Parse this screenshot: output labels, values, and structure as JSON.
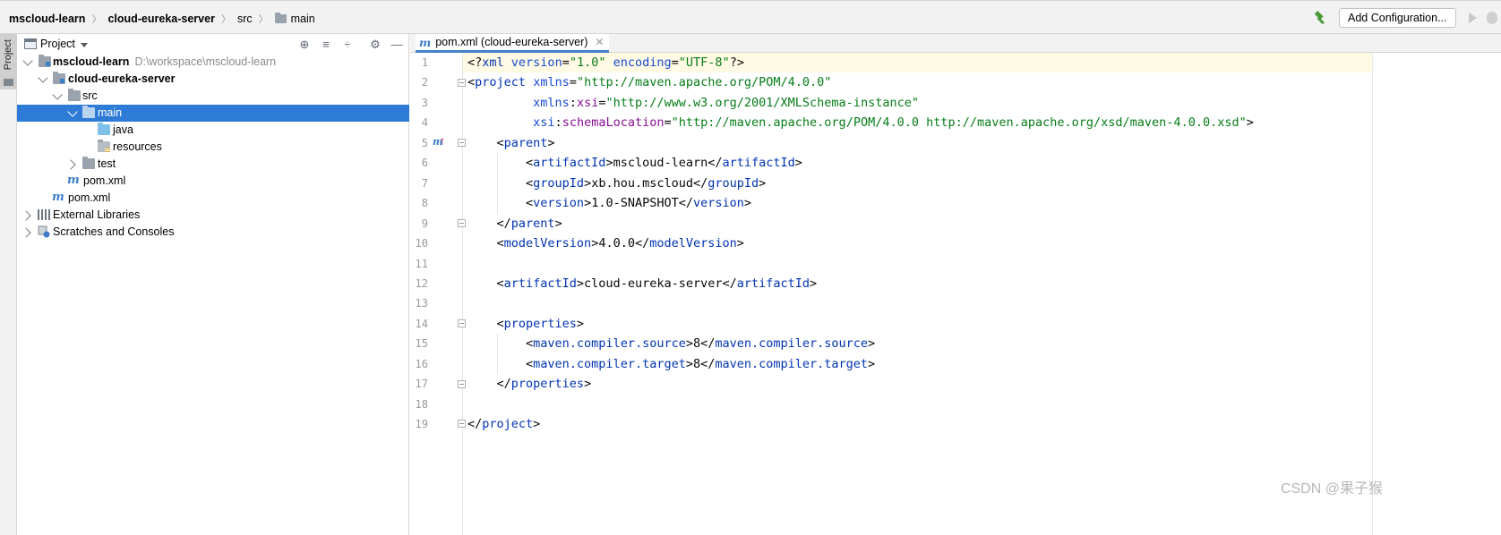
{
  "breadcrumb": {
    "items": [
      "mscloud-learn",
      "cloud-eureka-server",
      "src",
      "main"
    ]
  },
  "toolbar": {
    "add_configuration_label": "Add Configuration..."
  },
  "left_strip": {
    "project_label": "Project"
  },
  "project_panel": {
    "title": "Project",
    "tree": [
      {
        "label": "mscloud-learn",
        "path": "D:\\workspace\\mscloud-learn"
      },
      {
        "label": "cloud-eureka-server"
      },
      {
        "label": "src"
      },
      {
        "label": "main"
      },
      {
        "label": "java"
      },
      {
        "label": "resources"
      },
      {
        "label": "test"
      },
      {
        "label": "pom.xml"
      },
      {
        "label": "pom.xml"
      },
      {
        "label": "External Libraries"
      },
      {
        "label": "Scratches and Consoles"
      }
    ]
  },
  "editor": {
    "tab_label": "pom.xml (cloud-eureka-server)",
    "line_numbers": [
      "1",
      "2",
      "3",
      "4",
      "5",
      "6",
      "7",
      "8",
      "9",
      "10",
      "11",
      "12",
      "13",
      "14",
      "15",
      "16",
      "17",
      "18",
      "19"
    ],
    "lines": [
      "<?xml version=\"1.0\" encoding=\"UTF-8\"?>",
      "<project xmlns=\"http://maven.apache.org/POM/4.0.0\"",
      "         xmlns:xsi=\"http://www.w3.org/2001/XMLSchema-instance\"",
      "         xsi:schemaLocation=\"http://maven.apache.org/POM/4.0.0 http://maven.apache.org/xsd/maven-4.0.0.xsd\">",
      "    <parent>",
      "        <artifactId>mscloud-learn</artifactId>",
      "        <groupId>xb.hou.mscloud</groupId>",
      "        <version>1.0-SNAPSHOT</version>",
      "    </parent>",
      "    <modelVersion>4.0.0</modelVersion>",
      "",
      "    <artifactId>cloud-eureka-server</artifactId>",
      "",
      "    <properties>",
      "        <maven.compiler.source>8</maven.compiler.source>",
      "        <maven.compiler.target>8</maven.compiler.target>",
      "    </properties>",
      "",
      "</project>"
    ]
  },
  "watermark": "CSDN @果子猴",
  "colors": {
    "selection": "#2d7bd6",
    "tag": "#0033b3",
    "attribute": "#174ad4",
    "namespace": "#871094",
    "string": "#067d17",
    "tab_underline": "#4083c9"
  }
}
